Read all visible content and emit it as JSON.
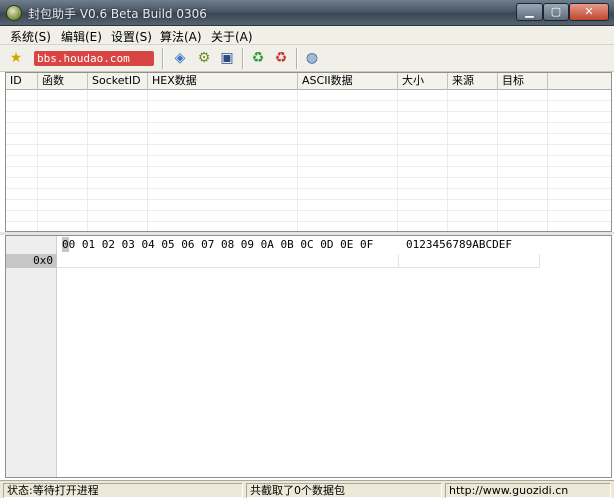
{
  "window": {
    "title": "封包助手 V0.6 Beta Build 0306",
    "min_label": "▁",
    "max_label": "▢",
    "close_label": "✕"
  },
  "menu": [
    {
      "label": "系统(S)"
    },
    {
      "label": "编辑(E)"
    },
    {
      "label": "设置(S)"
    },
    {
      "label": "算法(A)"
    },
    {
      "label": "关于(A)"
    }
  ],
  "toolbar": {
    "watermark": "bbs.houdao.com"
  },
  "packet_list": {
    "columns": [
      "ID",
      "函数",
      "SocketID",
      "HEX数据",
      "ASCII数据",
      "大小",
      "来源",
      "目标"
    ]
  },
  "hex_view": {
    "header_bytes": "00 01 02 03 04 05 06 07 08 09 0A 0B 0C 0D 0E 0F",
    "ascii_header": "0123456789ABCDEF",
    "row_offset": "0x0"
  },
  "status": {
    "state": "状态:等待打开进程",
    "count": "共截取了0个数据包",
    "url": "http://www.guozidi.cn"
  }
}
